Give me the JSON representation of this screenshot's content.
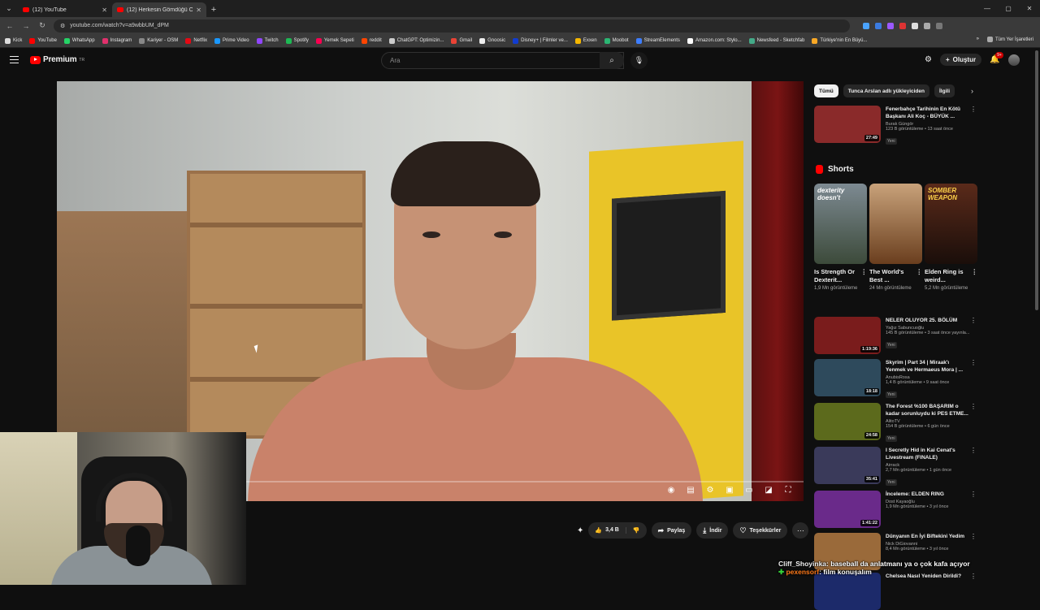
{
  "browser": {
    "tabs": [
      {
        "title": "(12) YouTube"
      },
      {
        "title": "(12) Herkesin Gömdüğü O..."
      }
    ],
    "url": "youtube.com/watch?v=a9wbbUM_dPM",
    "bookmarks": [
      "Kick",
      "YouTube",
      "WhatsApp",
      "Instagram",
      "Kariyer - OSM",
      "Netflix",
      "Prime Video",
      "Twitch",
      "Spotify",
      "Yemek Sepeti",
      "reddit",
      "ChatGPT: Optimizin...",
      "Gmail",
      "Gnoosic",
      "Disney+ | Filmler ve...",
      "Exxen",
      "Moobot",
      "StreamElements",
      "Amazon.com: Stylo...",
      "Newsfeed - Sketchfab",
      "Türkiye'nin En Büyü..."
    ],
    "bookmarks_all": "Tüm Yer İşaretleri"
  },
  "header": {
    "logo_text": "Premium",
    "logo_sup": "TR",
    "search_placeholder": "Ara",
    "create_label": "Oluştur",
    "notif_count": "9+"
  },
  "actions": {
    "like_count": "3,4 B",
    "share": "Paylaş",
    "download": "İndir",
    "thanks": "Teşekkürler"
  },
  "chips": [
    "Tümü",
    "Tunca Arslan adlı yükleyiciden",
    "İlgili"
  ],
  "recommendations_top": [
    {
      "title": "Fenerbahçe Tarihinin En Kötü Başkanı Ali Koç - BÜYÜK ...",
      "channel": "Burak Güngör",
      "meta": "123 B görüntüleme • 13 saat önce",
      "badge": "Yeni",
      "duration": "27:49",
      "thumb_color": "#8a2a2a"
    }
  ],
  "shorts": {
    "heading": "Shorts",
    "items": [
      {
        "title": "Is Strength Or Dexterit...",
        "views": "1,9 Mn görüntüleme",
        "overlay": "dexterity doesn't",
        "color": "#4b5a4a"
      },
      {
        "title": "The World's Best ...",
        "views": "24 Mn görüntüleme",
        "overlay": "",
        "color": "#7a4e2e"
      },
      {
        "title": "Elden Ring is weird...",
        "views": "5,2 Mn görüntüleme",
        "overlay": "SOMBER WEAPON",
        "color": "#3a1a14"
      }
    ]
  },
  "recommendations": [
    {
      "title": "NELER OLUYOR 25. BÖLÜM",
      "channel": "Yağız Sabuncuoğlu",
      "meta": "145 B görüntüleme • 3 saat önce yayınla...",
      "badge": "Yeni",
      "duration": "1:19:36",
      "thumb_color": "#7a1c1c"
    },
    {
      "title": "Skyrim | Part 34 | Miraak'ı Yenmek ve Hermaeus Mora | ...",
      "channel": "AnubisRosa",
      "meta": "1,4 B görüntüleme • 9 saat önce",
      "badge": "Yeni",
      "duration": "18:18",
      "thumb_color": "#2e4a5c"
    },
    {
      "title": "The Forest %100 BAŞARIM o kadar sorunluydu ki PES ETME...",
      "channel": "AlitoTV",
      "meta": "154 B görüntüleme • 6 gün önce",
      "badge": "Yeni",
      "duration": "24:58",
      "thumb_color": "#5c6a1c"
    },
    {
      "title": "I Secretly Hid in Kai Cenat's Livestream (FINALE)",
      "channel": "Airrack",
      "meta": "2,7 Mn görüntüleme • 1 gün önce",
      "badge": "Yeni",
      "duration": "35:41",
      "thumb_color": "#3a3a5a"
    },
    {
      "title": "İnceleme: ELDEN RING",
      "channel": "Dost Kayaoğlu",
      "meta": "1,9 Mn görüntüleme • 3 yıl önce",
      "badge": "",
      "duration": "1:41:22",
      "thumb_color": "#6a2a8a"
    },
    {
      "title": "Dünyanın En İyi Biftekini Yedim",
      "channel": "Nick DiGiovanni",
      "meta": "8,4 Mn görüntüleme • 3 yıl önce",
      "badge": "",
      "duration": "",
      "thumb_color": "#9a6a3a"
    },
    {
      "title": "Chelsea Nasıl Yeniden Dirildi?",
      "channel": "",
      "meta": "",
      "badge": "",
      "duration": "",
      "thumb_color": "#1c2a6a"
    }
  ],
  "chat": [
    {
      "user": "Cliff_Shoyinka",
      "text": ": baseball da anlatmanı ya o çok kafa açıyor"
    },
    {
      "user": "pexensorf",
      "text": ": film konuşalım"
    }
  ]
}
